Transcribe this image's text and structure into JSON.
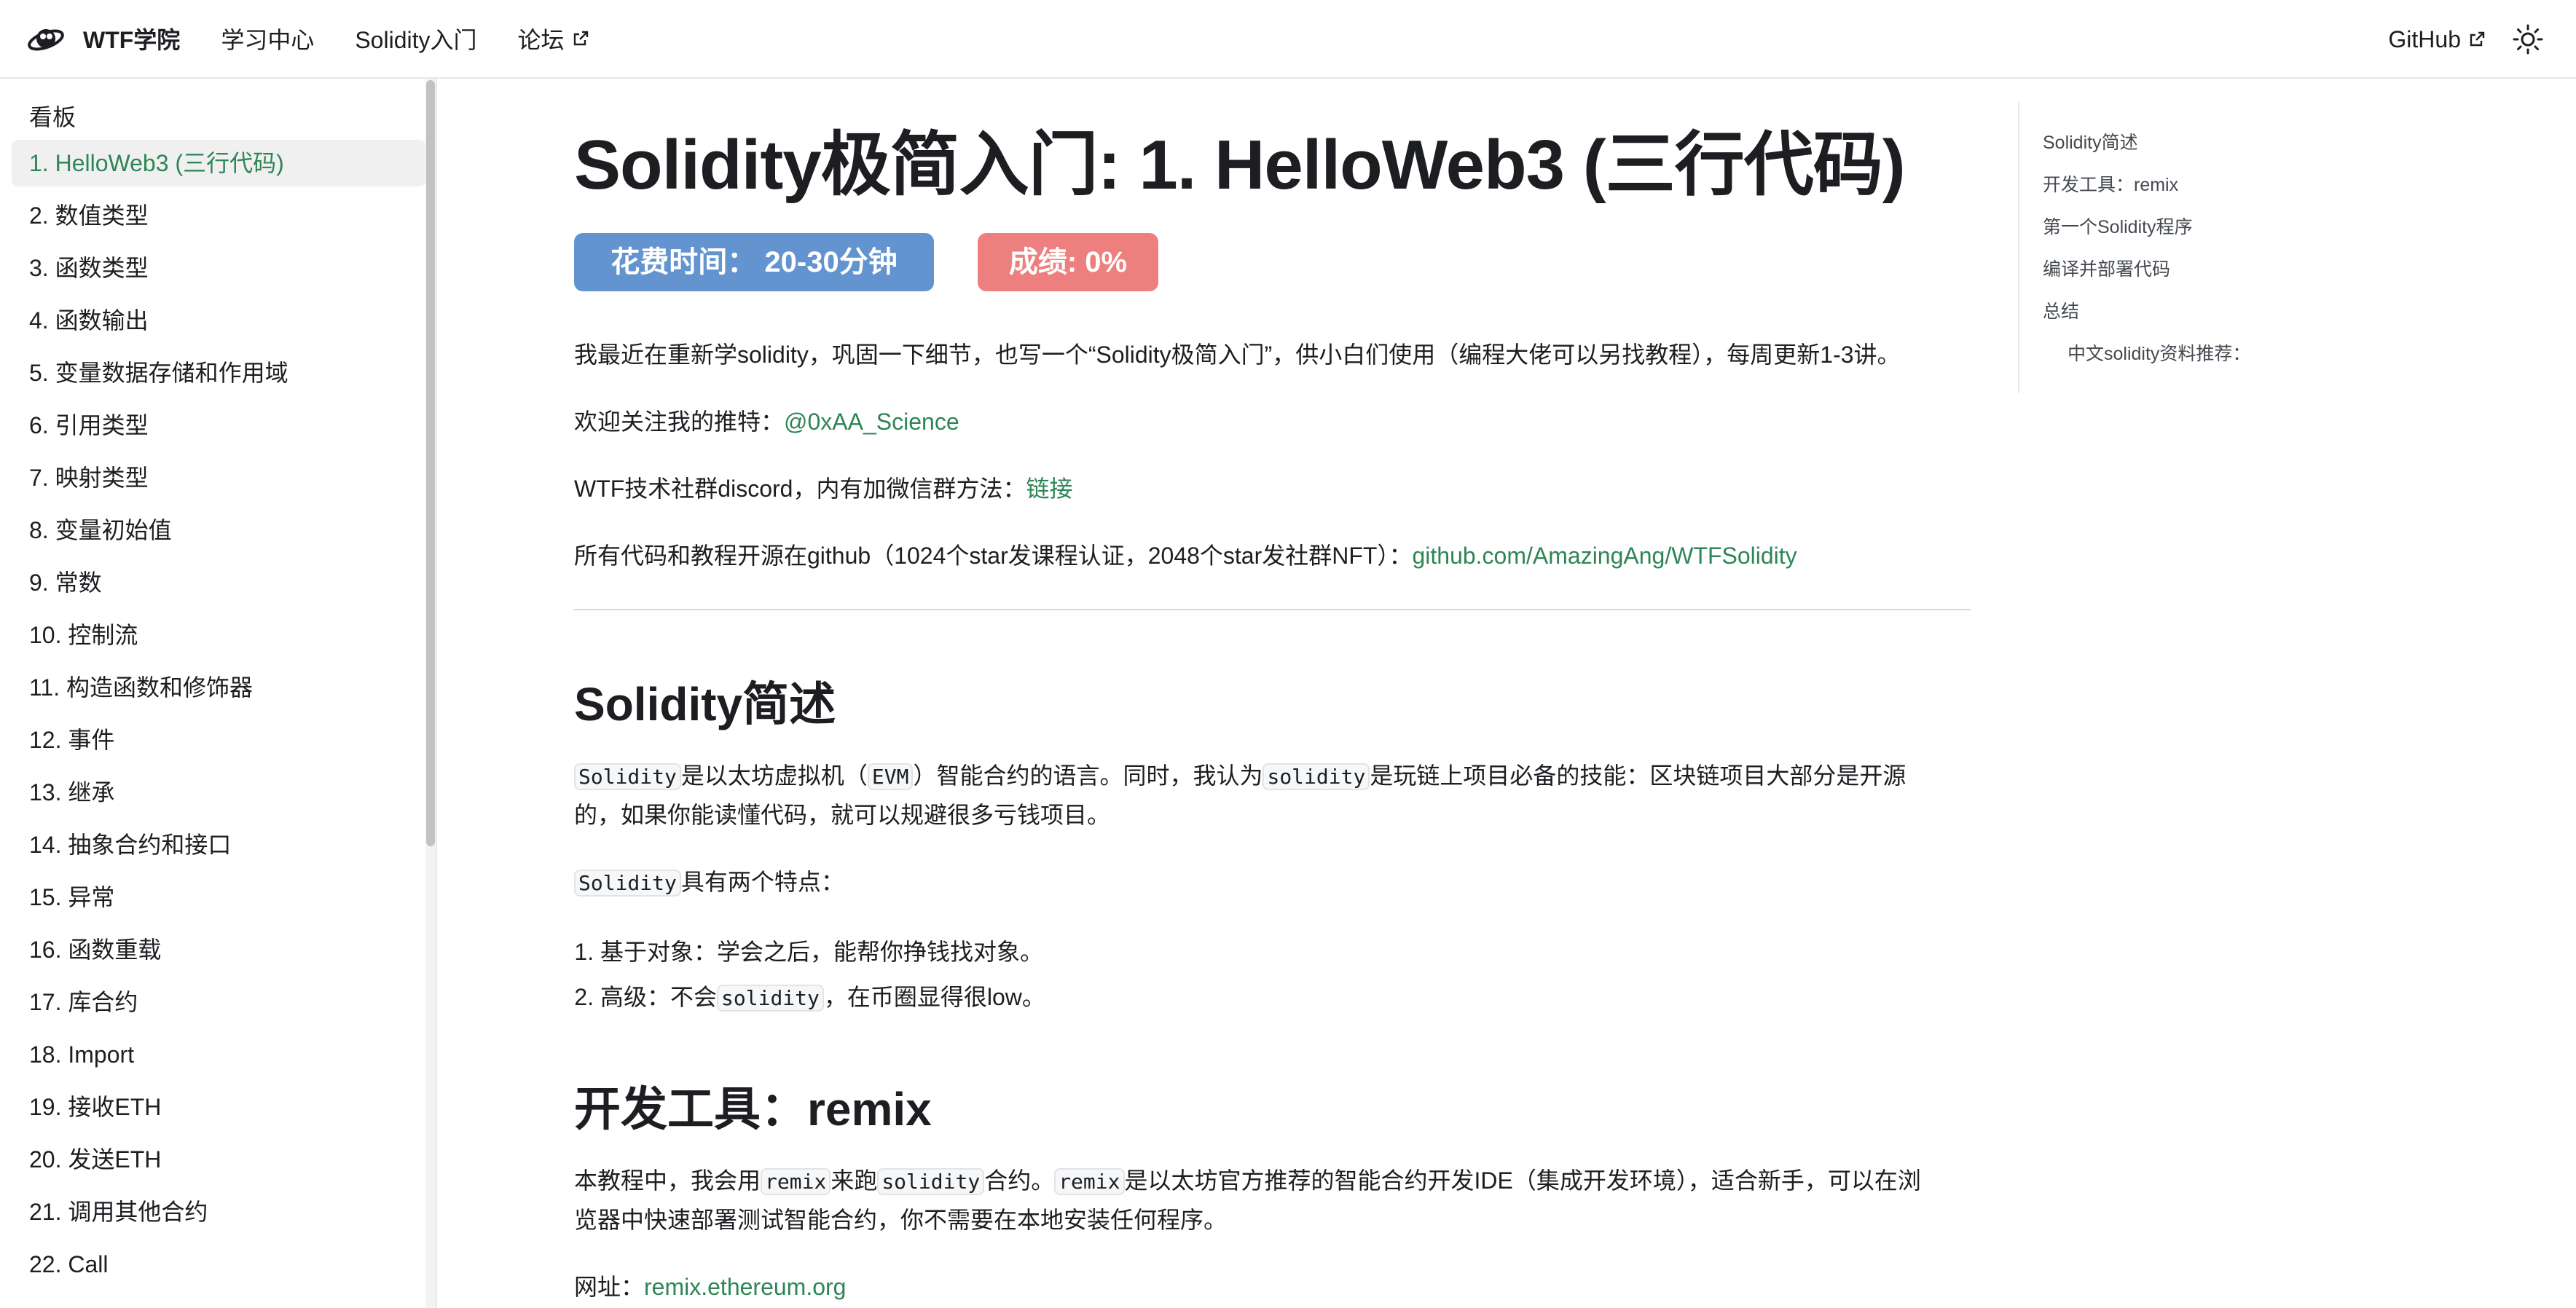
{
  "navbar": {
    "brand": "WTF学院",
    "items": [
      "学习中心",
      "Solidity入门",
      "论坛"
    ],
    "github": "GitHub"
  },
  "sidebar": {
    "title": "看板",
    "items": [
      "1. HelloWeb3 (三行代码)",
      "2. 数值类型",
      "3. 函数类型",
      "4. 函数输出",
      "5. 变量数据存储和作用域",
      "6. 引用类型",
      "7. 映射类型",
      "8. 变量初始值",
      "9. 常数",
      "10. 控制流",
      "11. 构造函数和修饰器",
      "12. 事件",
      "13. 继承",
      "14. 抽象合约和接口",
      "15. 异常",
      "16. 函数重载",
      "17. 库合约",
      "18. Import",
      "19. 接收ETH",
      "20. 发送ETH",
      "21. 调用其他合约",
      "22. Call"
    ]
  },
  "main": {
    "title": "Solidity极简入门: 1. HelloWeb3 (三行代码)",
    "badge_time": "花费时间： 20-30分钟",
    "badge_score": "成绩: 0%",
    "intro": "我最近在重新学solidity，巩固一下细节，也写一个“Solidity极简入门”，供小白们使用（编程大佬可以另找教程），每周更新1-3讲。",
    "follow_prefix": "欢迎关注我的推特：",
    "follow_link": "@0xAA_Science",
    "discord_prefix": "WTF技术社群discord，内有加微信群方法：",
    "discord_link": "链接",
    "github_prefix": "所有代码和教程开源在github（1024个star发课程认证，2048个star发社群NFT）：",
    "github_link": "github.com/AmazingAng/WTFSolidity",
    "section1_title": "Solidity简述",
    "s1": {
      "code_solidity": "Solidity",
      "text1": "是以太坊虚拟机（",
      "code_evm": "EVM",
      "text2": "）智能合约的语言。同时，我认为",
      "code_solidity2": "solidity",
      "text3": "是玩链上项目必备的技能：区块链项目大部分是开源",
      "line2": "的，如果你能读懂代码，就可以规避很多亏钱项目。"
    },
    "s1b": {
      "code": "Solidity",
      "text": "具有两个特点："
    },
    "list": {
      "item1": "基于对象：学会之后，能帮你挣钱找对象。",
      "item2_pre": "高级：不会",
      "item2_code": "solidity",
      "item2_post": "，在币圈显得很low。"
    },
    "section2_title": "开发工具：remix",
    "s2": {
      "t1": "本教程中，我会用",
      "c1": "remix",
      "t2": "来跑",
      "c2": "solidity",
      "t3": "合约。",
      "c3": "remix",
      "t4": "是以太坊官方推荐的智能合约开发IDE（集成开发环境），适合新手，可以在浏",
      "line2": "览器中快速部署测试智能合约，你不需要在本地安装任何程序。"
    },
    "url_prefix": "网址：",
    "url_link": "remix.ethereum.org"
  },
  "toc": {
    "items": [
      "Solidity简述",
      "开发工具：remix",
      "第一个Solidity程序",
      "编译并部署代码",
      "总结"
    ],
    "sub_items": [
      "中文solidity资料推荐："
    ]
  },
  "colors": {
    "link": "#2e8555",
    "badge_time": "#6394d0",
    "badge_score": "#ee7f7f",
    "active_bg": "#f0f0f0"
  },
  "icons": [
    "wtf-logo-icon",
    "external-link-icon",
    "sun-icon"
  ]
}
